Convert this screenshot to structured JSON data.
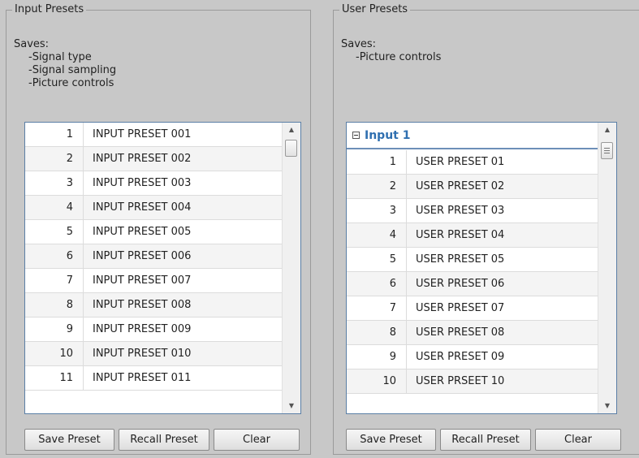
{
  "input_presets": {
    "legend": "Input Presets",
    "saves_label": "Saves:",
    "saves_items": [
      "-Signal type",
      "-Signal sampling",
      "-Picture controls"
    ],
    "rows": [
      {
        "num": "1",
        "name": "INPUT PRESET 001"
      },
      {
        "num": "2",
        "name": "INPUT PRESET 002"
      },
      {
        "num": "3",
        "name": "INPUT PRESET 003"
      },
      {
        "num": "4",
        "name": "INPUT PRESET 004"
      },
      {
        "num": "5",
        "name": "INPUT PRESET 005"
      },
      {
        "num": "6",
        "name": "INPUT PRESET 006"
      },
      {
        "num": "7",
        "name": "INPUT PRESET 007"
      },
      {
        "num": "8",
        "name": "INPUT PRESET 008"
      },
      {
        "num": "9",
        "name": "INPUT PRESET 009"
      },
      {
        "num": "10",
        "name": "INPUT PRESET 010"
      },
      {
        "num": "11",
        "name": "INPUT PRESET 011"
      }
    ],
    "buttons": {
      "save": "Save Preset",
      "recall": "Recall Preset",
      "clear": "Clear"
    }
  },
  "user_presets": {
    "legend": "User Presets",
    "saves_label": "Saves:",
    "saves_items": [
      "-Picture controls"
    ],
    "group_header": "Input 1",
    "rows": [
      {
        "num": "1",
        "name": "USER PRESET 01"
      },
      {
        "num": "2",
        "name": "USER PRESET 02"
      },
      {
        "num": "3",
        "name": "USER PRESET 03"
      },
      {
        "num": "4",
        "name": "USER PRESET 04"
      },
      {
        "num": "5",
        "name": "USER PRESET 05"
      },
      {
        "num": "6",
        "name": "USER PRESET 06"
      },
      {
        "num": "7",
        "name": "USER PRESET 07"
      },
      {
        "num": "8",
        "name": "USER PRESET 08"
      },
      {
        "num": "9",
        "name": "USER PRESET 09"
      },
      {
        "num": "10",
        "name": "USER PRSEET 10"
      }
    ],
    "buttons": {
      "save": "Save Preset",
      "recall": "Recall Preset",
      "clear": "Clear"
    }
  },
  "icons": {
    "collapse": "minus-box-icon",
    "scroll_up": "triangle-up-icon",
    "scroll_down": "triangle-down-icon"
  },
  "colors": {
    "background": "#c8c8c8",
    "group_header_text": "#2f6fb0",
    "list_border": "#5b7fa6"
  }
}
